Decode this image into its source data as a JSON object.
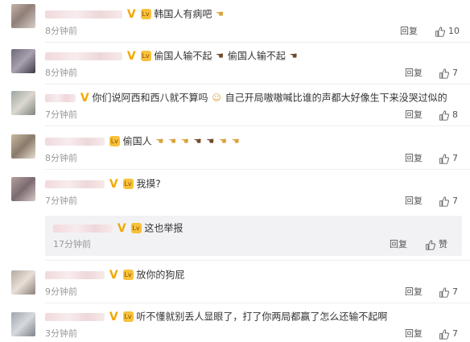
{
  "comments": [
    {
      "text": "韩国人有病吧",
      "emojis": [
        "👎"
      ],
      "time": "8分钟前",
      "reply": "回复",
      "likes": "10"
    },
    {
      "text": "偷国人输不起",
      "text2": "偷国人输不起",
      "time": "8分钟前",
      "reply": "回复",
      "likes": "7"
    },
    {
      "text": "你们说阿西和西八就不算吗",
      "text2": "自己开局嗷嗷喊比谁的声都大好像生下来没哭过似的",
      "time": "7分钟前",
      "reply": "回复",
      "likes": "8"
    },
    {
      "text": "偷国人",
      "time": "8分钟前",
      "reply": "回复",
      "likes": "7"
    },
    {
      "text": "我摸?",
      "time": "7分钟前",
      "reply": "回复",
      "likes": "7"
    },
    {
      "text": "放你的狗屁",
      "time": "9分钟前",
      "reply": "回复",
      "likes": "7"
    },
    {
      "text": "听不懂就别丢人显眼了，打了你两局都赢了怎么还输不起啊",
      "time": "3分钟前",
      "reply": "回复",
      "likes": "7"
    }
  ],
  "subreply": {
    "text": "这也举报",
    "time": "17分钟前",
    "reply": "回复",
    "likes": "赞"
  },
  "badge_v": "V",
  "badge_lv": "Lv",
  "colors": {
    "badge": "#f2a900",
    "time": "#999999",
    "text": "#333333"
  }
}
